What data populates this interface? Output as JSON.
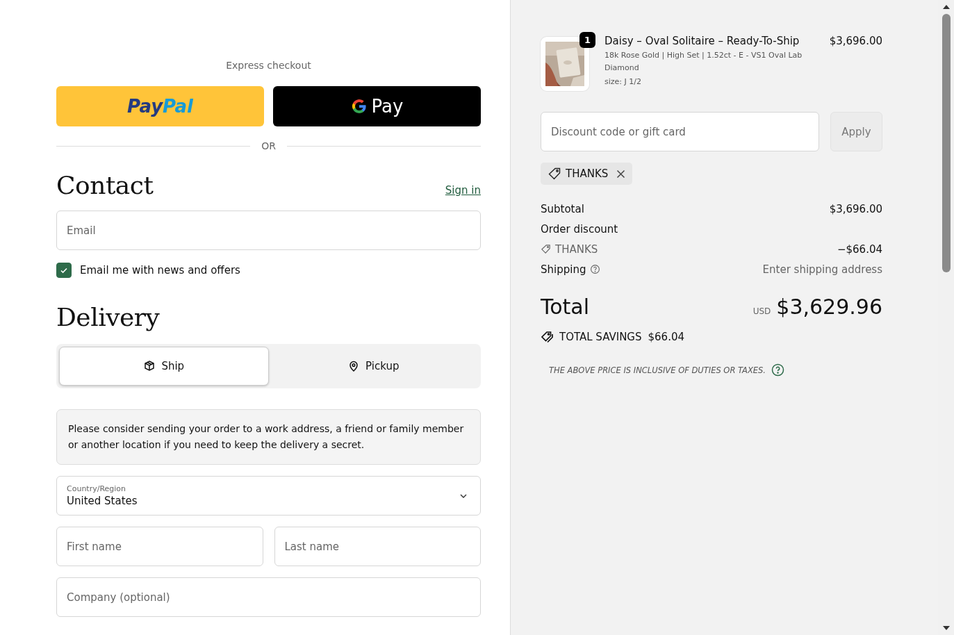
{
  "express_checkout": {
    "title": "Express checkout",
    "buttons": [
      {
        "kind": "paypal",
        "label": "Pay",
        "label_2": "Pal"
      },
      {
        "kind": "gpay",
        "label": "Pay"
      }
    ],
    "divider": "OR"
  },
  "contact": {
    "heading": "Contact",
    "sign_in": "Sign in",
    "email": {
      "placeholder": "Email"
    },
    "newsletter": {
      "label": "Email me with news and offers",
      "checked": true
    }
  },
  "delivery": {
    "heading": "Delivery",
    "options": [
      {
        "kind": "ship",
        "label": "Ship",
        "selected": true
      },
      {
        "kind": "pickup",
        "label": "Pickup",
        "selected": false
      }
    ],
    "notice": "Please consider sending your order to a work address, a friend or family member or another location if you need to keep the delivery a secret.",
    "country": {
      "label": "Country/Region",
      "value": "United States"
    },
    "first_name": {
      "placeholder": "First name"
    },
    "last_name": {
      "placeholder": "Last name"
    },
    "company": {
      "placeholder": "Company (optional)"
    }
  },
  "summary": {
    "item": {
      "quantity": "1",
      "name": "Daisy – Oval Solitaire – Ready-To-Ship",
      "variant": "18k Rose Gold | High Set | 1.52ct - E - VS1 Oval Lab Diamond",
      "size": "size: J 1/2",
      "price": "$3,696.00"
    },
    "discount": {
      "placeholder": "Discount code or gift card",
      "button": "Apply",
      "applied_code": "THANKS"
    },
    "lines": [
      {
        "kind": "amount",
        "label": "Subtotal",
        "value": "$3,696.00"
      },
      {
        "kind": "heading",
        "label": "Order discount"
      },
      {
        "kind": "discount",
        "label": "THANKS",
        "value": "−$66.04"
      },
      {
        "kind": "shipping",
        "label": "Shipping",
        "value": "Enter shipping address"
      }
    ],
    "total": {
      "label": "Total",
      "currency": "USD",
      "value": "$3,629.96"
    },
    "savings": {
      "label": "TOTAL SAVINGS",
      "value": "$66.04"
    },
    "tax_note": "THE ABOVE PRICE IS INCLUSIVE OF DUTIES OR TAXES."
  }
}
